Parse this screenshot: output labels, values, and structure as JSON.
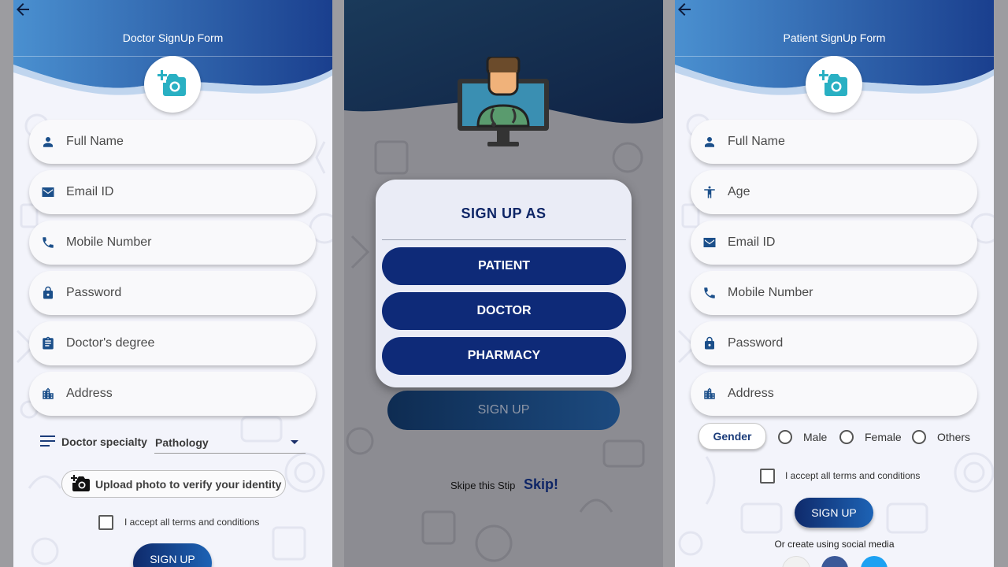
{
  "doctor_form": {
    "title": "Doctor SignUp Form",
    "fields": {
      "full_name": "Full Name",
      "email": "Email ID",
      "mobile": "Mobile Number",
      "password": "Password",
      "degree": "Doctor's degree",
      "address": "Address"
    },
    "specialty_label": "Doctor specialty",
    "specialty_value": "Pathology",
    "upload_label": "Upload photo to verify your identity",
    "terms_label": "I accept all terms and conditions",
    "signup_label": "SIGN UP"
  },
  "signup_modal": {
    "title": "SIGN UP AS",
    "options": {
      "patient": "PATIENT",
      "doctor": "DOCTOR",
      "pharmacy": "PHARMACY"
    },
    "signup_label": "SIGN UP",
    "skip_text": "Skipe this Stip",
    "skip_link": "Skip!"
  },
  "patient_form": {
    "title": "Patient SignUp Form",
    "fields": {
      "full_name": "Full Name",
      "age": "Age",
      "email": "Email ID",
      "mobile": "Mobile Number",
      "password": "Password",
      "address": "Address"
    },
    "gender_label": "Gender",
    "gender_options": {
      "male": "Male",
      "female": "Female",
      "others": "Others"
    },
    "terms_label": "I accept all terms and conditions",
    "signup_label": "SIGN UP",
    "social_text": "Or create using social media"
  },
  "colors": {
    "primary_dark": "#0e2a78",
    "header_blue": "#1f4f9e",
    "accent_teal": "#2bb3c6",
    "icon_blue": "#1b4f8a"
  },
  "icons": [
    "back-arrow-icon",
    "add-photo-icon",
    "person-icon",
    "email-icon",
    "phone-icon",
    "lock-icon",
    "clipboard-icon",
    "building-icon",
    "menu-lines-icon",
    "camera-plus-icon",
    "doctor-monitor-icon",
    "accessibility-icon"
  ]
}
